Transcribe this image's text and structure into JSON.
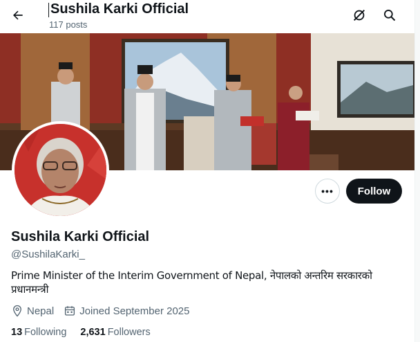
{
  "header": {
    "title": "Sushila Karki Official",
    "posts_count": "117 posts"
  },
  "profile": {
    "display_name": "Sushila Karki Official",
    "handle": "@SushilaKarki_",
    "bio": "Prime Minister of the Interim Government of Nepal, नेपालको अन्तरिम सरकारको प्रधानमन्त्री",
    "location": "Nepal",
    "joined": "Joined September 2025",
    "following_count": "13",
    "following_label": "Following",
    "followers_count": "2,631",
    "followers_label": "Followers"
  },
  "actions": {
    "more_label": "•••",
    "follow_label": "Follow"
  },
  "icons": {
    "back": "arrow-left-icon",
    "grok": "grok-icon",
    "search": "search-icon",
    "location": "location-pin-icon",
    "calendar": "calendar-icon"
  },
  "colors": {
    "text_primary": "#0f1419",
    "text_secondary": "#536471",
    "follow_button_bg": "#0f1419",
    "border": "#cfd9de"
  }
}
